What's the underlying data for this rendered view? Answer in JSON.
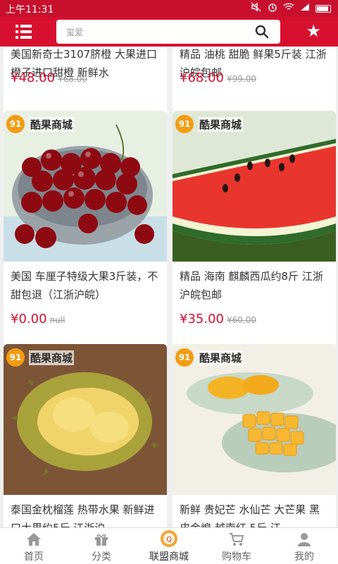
{
  "status": {
    "time": "上午11:31"
  },
  "search": {
    "placeholder": "玺爱"
  },
  "brand": {
    "badge": "91",
    "name": "酷果商城"
  },
  "products": [
    {
      "title": "美国新奇士3107脐橙 大果进口橙子进口甜橙 新鲜水",
      "price": "¥48.00",
      "old_price": "¥68.00"
    },
    {
      "title": "精品 油桃 甜脆 鲜果5斤装 江浙沪皖包邮",
      "price": "¥68.00",
      "old_price": "¥99.00"
    },
    {
      "title": "美国 车厘子特级大果3斤装，不甜包退（江浙沪皖）",
      "price": "¥0.00",
      "old_price": "null"
    },
    {
      "title": "精品 海南 麒麟西瓜约8斤 江浙沪皖包邮",
      "price": "¥35.00",
      "old_price": "¥60.00"
    },
    {
      "title": "泰国金枕榴莲 热带水果 新鲜进口大果约5斤 江浙沪",
      "price": "",
      "old_price": ""
    },
    {
      "title": "新鲜 贵妃芒 水仙芒 大芒果 黑皮金煌 越南红 5斤 江",
      "price": "",
      "old_price": ""
    }
  ],
  "nav": [
    {
      "label": "首页",
      "icon": "home-icon"
    },
    {
      "label": "分类",
      "icon": "gift-icon"
    },
    {
      "label": "联盟商城",
      "icon": "store-badge-icon"
    },
    {
      "label": "购物车",
      "icon": "cart-icon"
    },
    {
      "label": "我的",
      "icon": "user-icon"
    }
  ],
  "colors": {
    "primary": "#d8102f",
    "price": "#d8102f"
  }
}
